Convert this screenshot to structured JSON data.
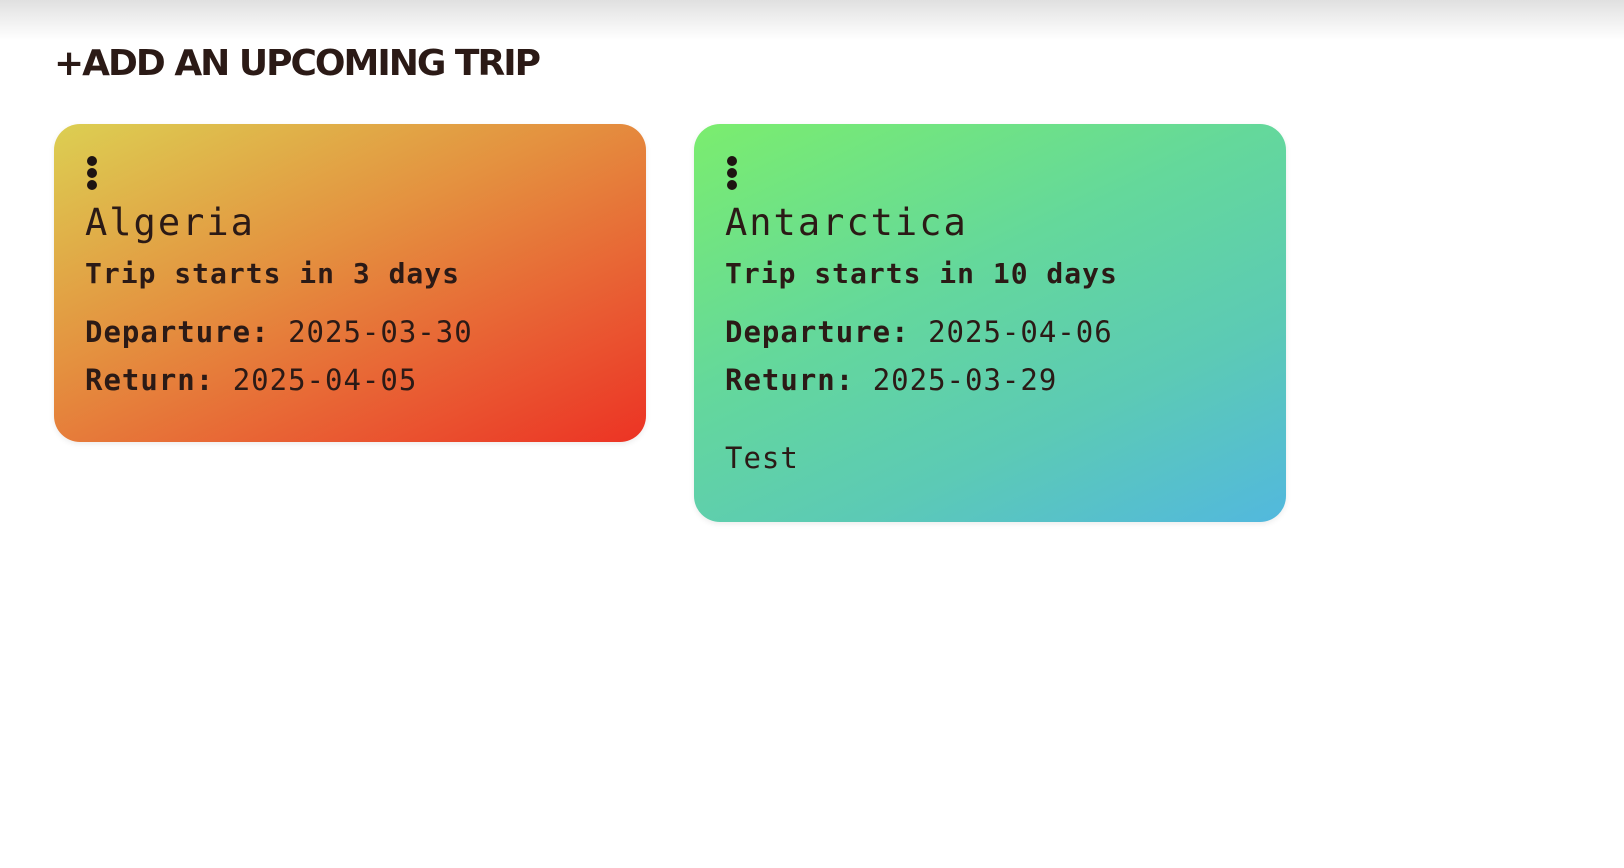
{
  "header": {
    "add_trip_label": "+ADD AN UPCOMING TRIP"
  },
  "trips": [
    {
      "country": "Algeria",
      "countdown": "Trip starts in 3 days",
      "departure_label": "Departure:",
      "departure": "2025-03-30",
      "return_label": "Return:",
      "return": "2025-04-05",
      "note": "",
      "menu_icon": "vertical-ellipsis-icon",
      "gradient": [
        "#dccf52",
        "#e4903f",
        "#ec3324"
      ]
    },
    {
      "country": "Antarctica",
      "countdown": "Trip starts in 10 days",
      "departure_label": "Departure:",
      "departure": "2025-04-06",
      "return_label": "Return:",
      "return": "2025-03-29",
      "note": "Test",
      "menu_icon": "vertical-ellipsis-icon",
      "gradient": [
        "#7bed6e",
        "#5ccab5",
        "#52b8de"
      ]
    }
  ]
}
